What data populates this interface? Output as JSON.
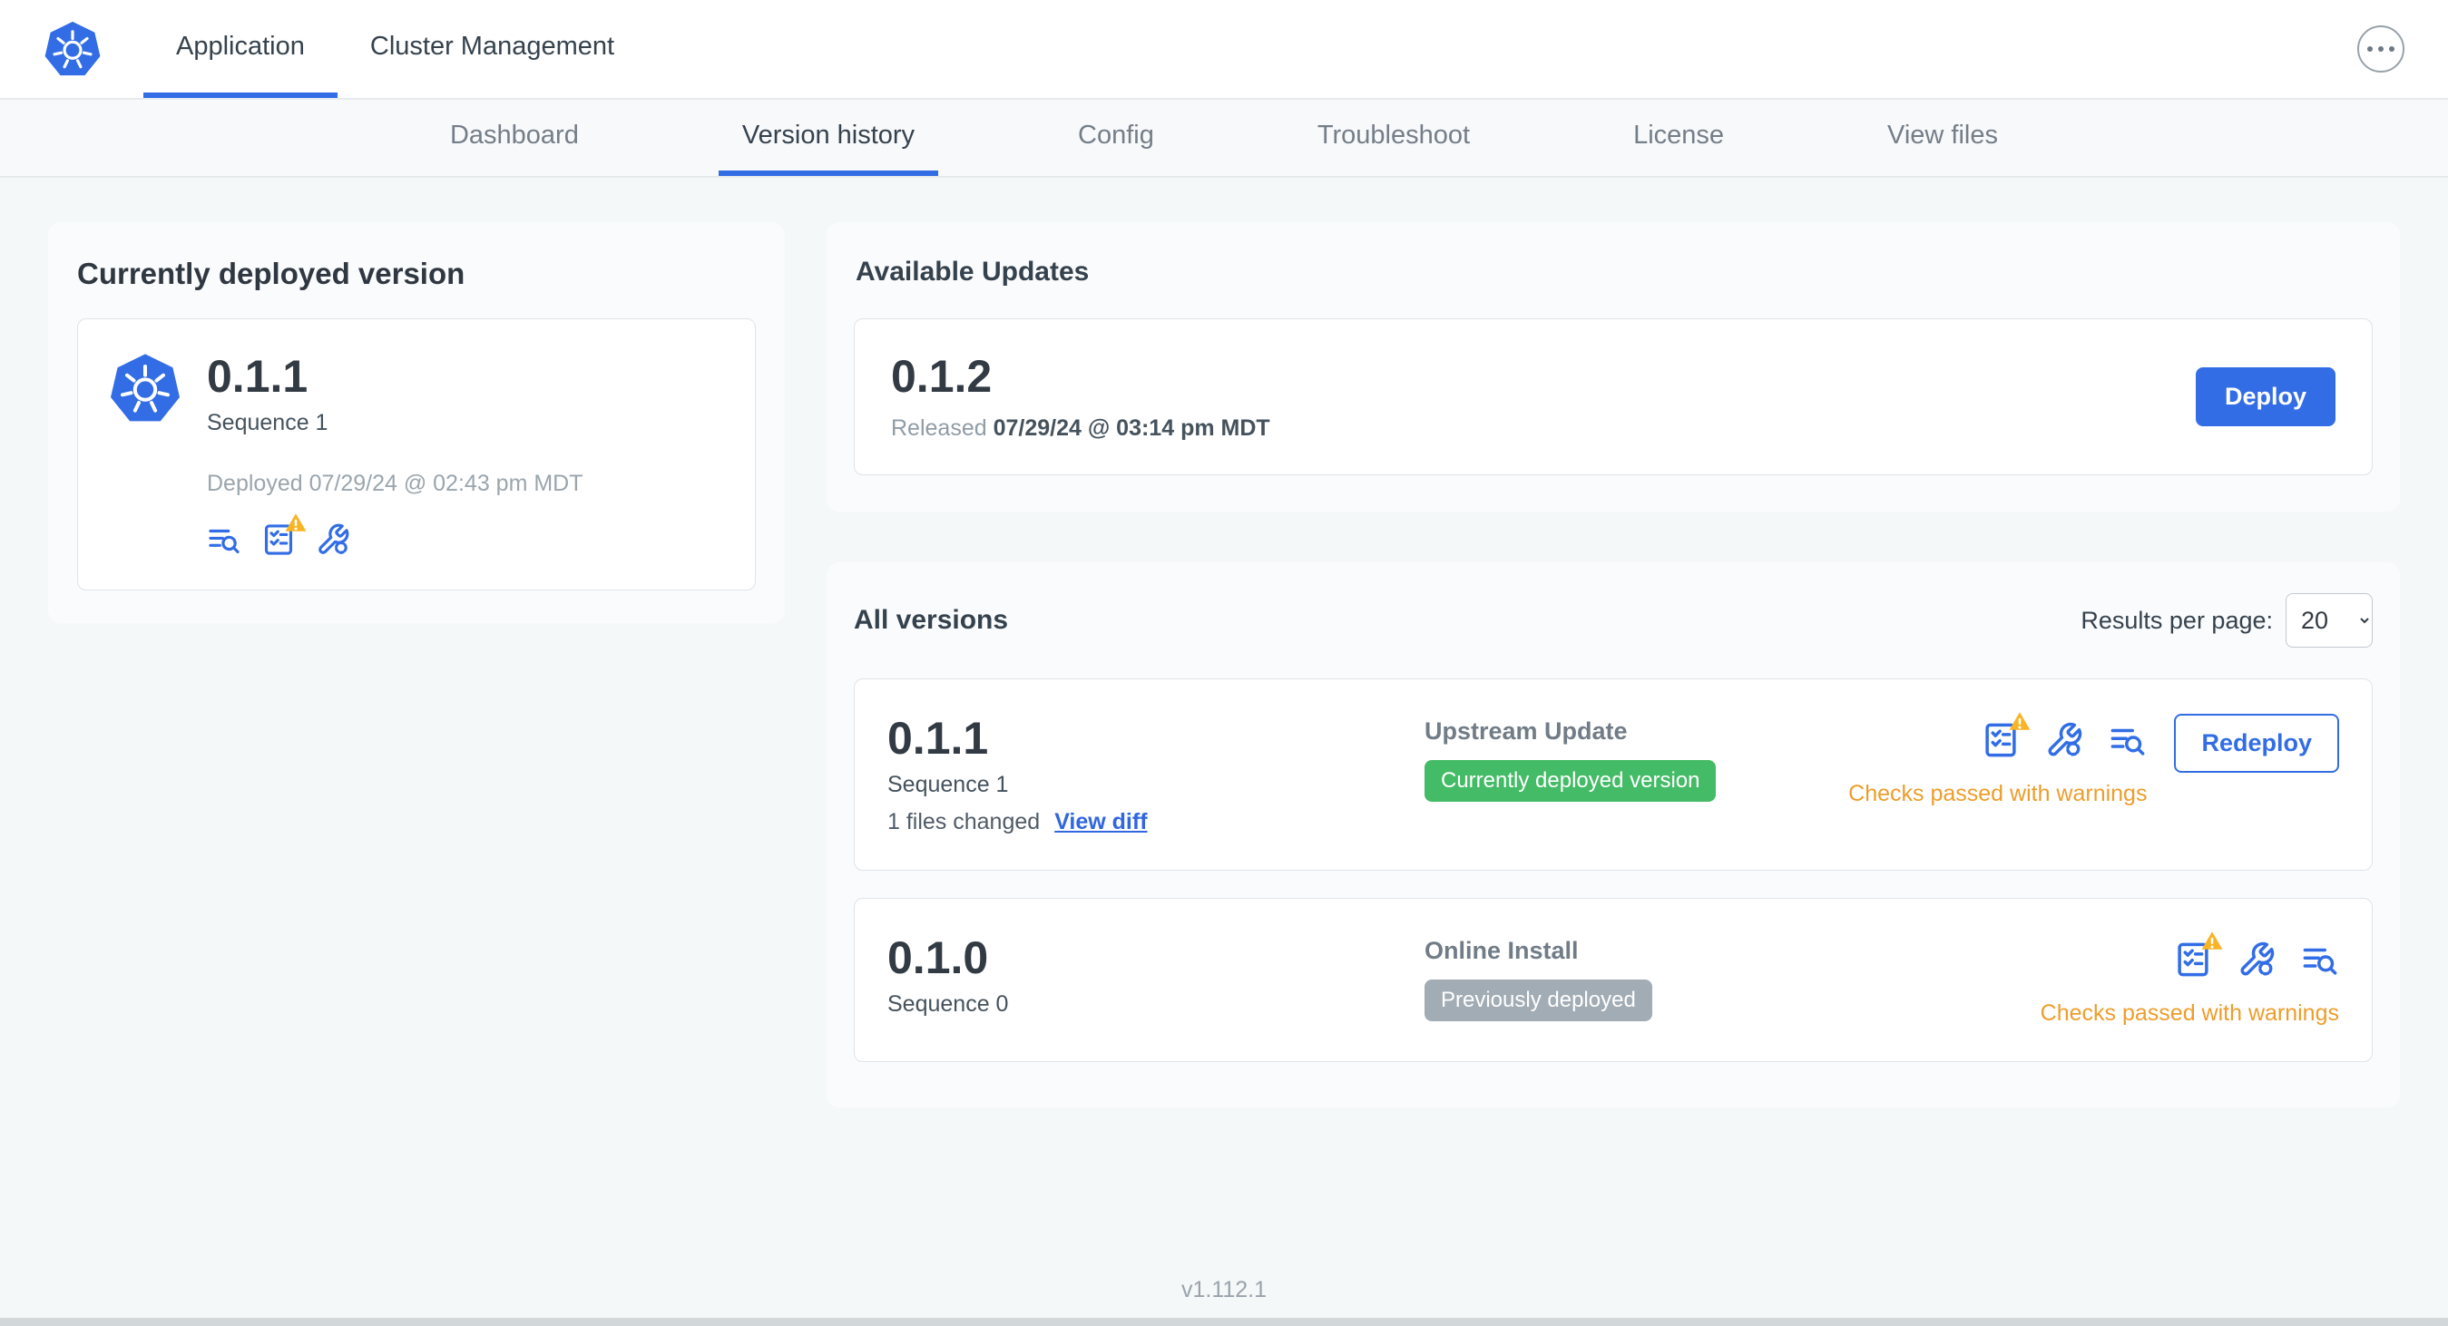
{
  "colors": {
    "accent_blue": "#326de6",
    "link_blue": "#3066e0",
    "warning_text_orange": "#ee9d2b",
    "warning_triangle_yellow": "#f8b425",
    "badge_green": "#44bb66",
    "badge_gray": "#a2acb4",
    "page_background": "#f5f8f9"
  },
  "header": {
    "logo_icon": "kubernetes-logo",
    "tabs": [
      {
        "label": "Application",
        "active": true
      },
      {
        "label": "Cluster Management",
        "active": false
      }
    ],
    "more_icon": "ellipsis-icon"
  },
  "subnav": {
    "tabs": [
      {
        "label": "Dashboard",
        "active": false
      },
      {
        "label": "Version history",
        "active": true
      },
      {
        "label": "Config",
        "active": false
      },
      {
        "label": "Troubleshoot",
        "active": false
      },
      {
        "label": "License",
        "active": false
      },
      {
        "label": "View files",
        "active": false
      }
    ]
  },
  "current_version": {
    "title": "Currently deployed version",
    "version": "0.1.1",
    "sequence": "Sequence 1",
    "deployed_timestamp": "Deployed 07/29/24 @ 02:43 pm MDT",
    "icons": [
      "deploy-logs-icon",
      "preflight-checks-warning-icon",
      "config-icon"
    ]
  },
  "available_updates": {
    "title": "Available Updates",
    "version": "0.1.2",
    "released_label": "Released",
    "released_timestamp": "07/29/24 @ 03:14 pm MDT",
    "deploy_button": "Deploy"
  },
  "all_versions": {
    "title": "All versions",
    "results_per_page": {
      "label": "Results per page:",
      "value": "20"
    },
    "rows": [
      {
        "version": "0.1.1",
        "sequence": "Sequence 1",
        "files_changed": "1 files changed",
        "view_diff": "View diff",
        "source": "Upstream Update",
        "badge": "Currently deployed version",
        "badge_color": "#44bb66",
        "status": "Checks passed with warnings",
        "action": "Redeploy",
        "icons": [
          "preflight-checks-warning-icon",
          "config-icon",
          "deploy-logs-icon"
        ]
      },
      {
        "version": "0.1.0",
        "sequence": "Sequence 0",
        "source": "Online Install",
        "badge": "Previously deployed",
        "badge_color": "#a2acb4",
        "status": "Checks passed with warnings",
        "icons": [
          "preflight-checks-warning-icon",
          "config-icon",
          "deploy-logs-icon"
        ]
      }
    ]
  },
  "footer": {
    "app_version": "v1.112.1"
  }
}
